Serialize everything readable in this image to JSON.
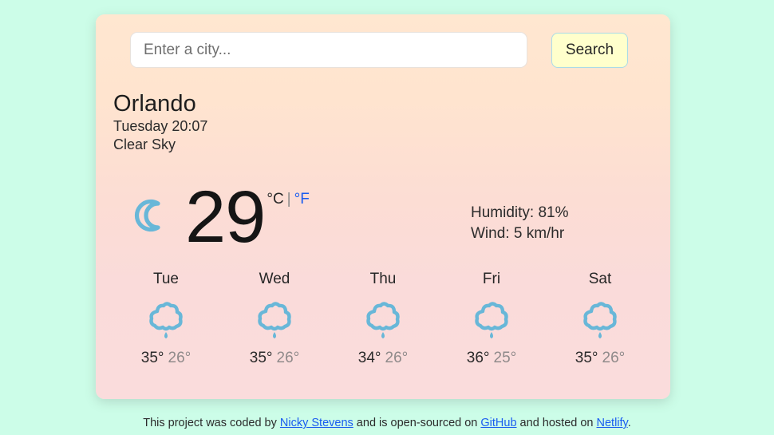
{
  "theme": {
    "page_background": "#ccfde8",
    "card_gradient_top": "#ffe7d0",
    "card_gradient_bottom": "#fadcdc",
    "icon_blue": "#68b7d8",
    "link_blue": "#1a5cf0",
    "button_background": "#ffffcc",
    "button_border": "#a9dbe8"
  },
  "search": {
    "placeholder": "Enter a city...",
    "value": "",
    "button_label": "Search"
  },
  "current": {
    "city": "Orlando",
    "datetime": "Tuesday 20:07",
    "description": "Clear Sky",
    "icon": "crescent-moon-icon",
    "temperature": "29",
    "unit_celsius": "°C",
    "unit_separator": "|",
    "unit_fahrenheit": "°F",
    "active_unit": "celsius",
    "humidity": "Humidity: 81%",
    "wind": "Wind: 5 km/hr"
  },
  "forecast": [
    {
      "day": "Tue",
      "icon": "cloud-rain-icon",
      "max": "35°",
      "min": "26°"
    },
    {
      "day": "Wed",
      "icon": "cloud-rain-icon",
      "max": "35°",
      "min": "26°"
    },
    {
      "day": "Thu",
      "icon": "cloud-rain-icon",
      "max": "34°",
      "min": "26°"
    },
    {
      "day": "Fri",
      "icon": "cloud-rain-icon",
      "max": "36°",
      "min": "25°"
    },
    {
      "day": "Sat",
      "icon": "cloud-rain-icon",
      "max": "35°",
      "min": "26°"
    }
  ],
  "footer": {
    "text_1": "This project was coded by ",
    "link_author": "Nicky Stevens",
    "text_2": " and is open-sourced on ",
    "link_source": "GitHub",
    "text_3": " and hosted on ",
    "link_host": "Netlify",
    "text_4": "."
  }
}
